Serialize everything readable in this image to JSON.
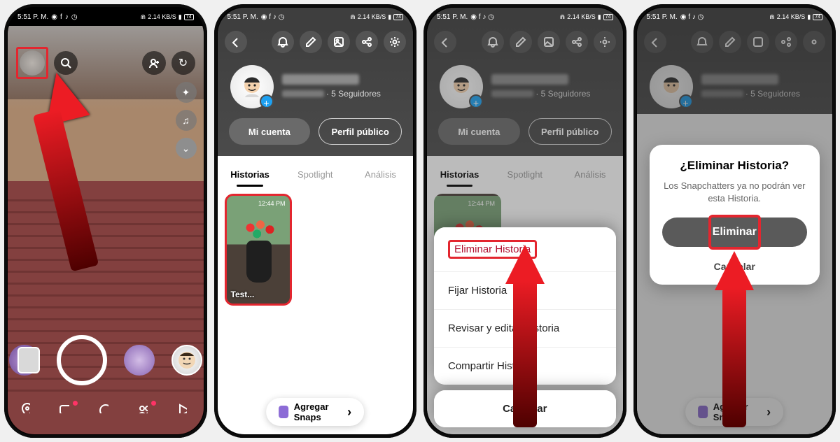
{
  "status": {
    "time": "5:51 P. M.",
    "net_label": "2.14 KB/S",
    "battery": "74"
  },
  "camera": {
    "flip_hint": "↻"
  },
  "profile": {
    "followers_suffix": " · 5 Seguidores",
    "btn_account": "Mi cuenta",
    "btn_public": "Perfil público",
    "tabs": {
      "historias": "Historias",
      "spotlight": "Spotlight",
      "analisis": "Análisis"
    },
    "story": {
      "time": "12:44 PM",
      "label": "Test..."
    },
    "add_snaps": "Agregar Snaps"
  },
  "action_sheet": {
    "delete": "Eliminar Historia",
    "pin": "Fijar Historia",
    "review": "Revisar y editar Historia",
    "share": "Compartir Historia",
    "cancel": "Cancelar"
  },
  "modal": {
    "title": "¿Eliminar Historia?",
    "body": "Los Snapchatters ya no podrán ver esta Historia.",
    "confirm": "Eliminar",
    "cancel": "Cancelar"
  },
  "chevron": "›"
}
